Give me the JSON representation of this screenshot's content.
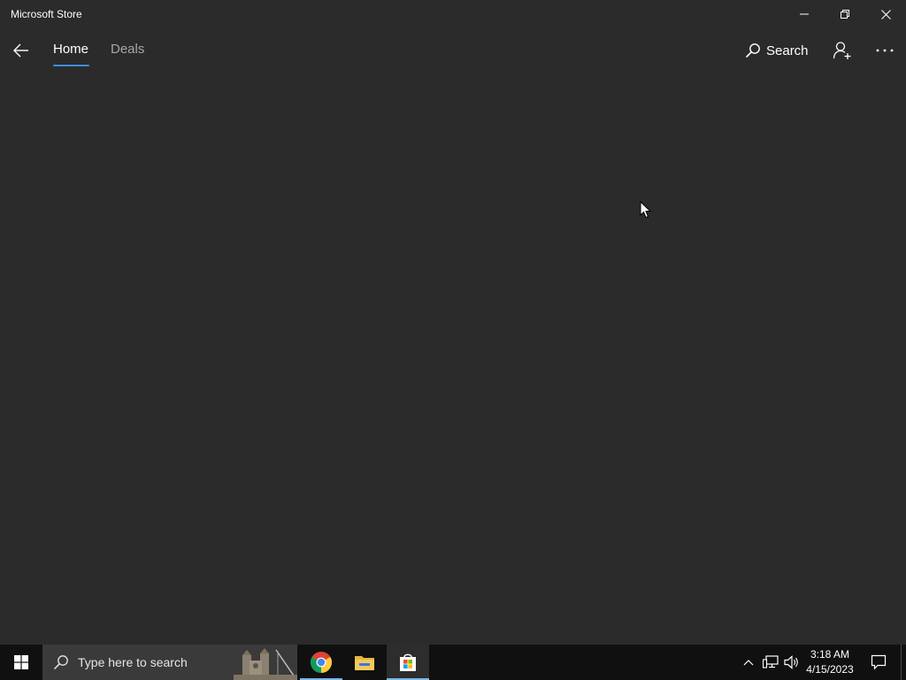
{
  "window": {
    "title": "Microsoft Store"
  },
  "titlebar_controls": {
    "minimize_icon": "minimize-icon",
    "restore_icon": "restore-icon",
    "close_icon": "close-icon"
  },
  "nav": {
    "back_icon": "back-arrow-icon",
    "tabs": [
      {
        "label": "Home",
        "active": true
      },
      {
        "label": "Deals",
        "active": false
      }
    ],
    "search_label": "Search",
    "search_icon": "search-icon",
    "user_icon": "add-user-icon",
    "more_icon": "more-icon"
  },
  "colors": {
    "background": "#2b2b2b",
    "accent": "#3d8ee6",
    "taskbar": "#101010",
    "inactive_text": "#a6a6a6"
  },
  "taskbar": {
    "search_placeholder": "Type here to search",
    "apps": [
      {
        "name": "Google Chrome",
        "icon": "chrome-icon"
      },
      {
        "name": "File Explorer",
        "icon": "folder-icon"
      },
      {
        "name": "Microsoft Store",
        "icon": "store-icon",
        "active": true
      }
    ],
    "clock": {
      "time": "3:18 AM",
      "date": "4/15/2023"
    }
  }
}
